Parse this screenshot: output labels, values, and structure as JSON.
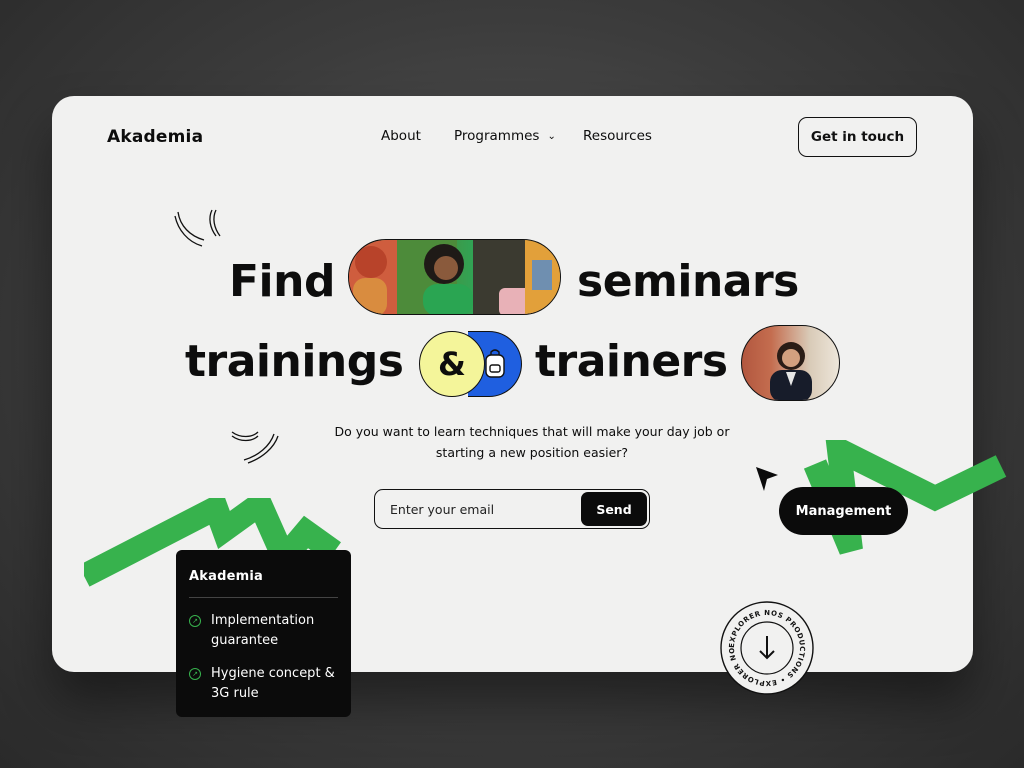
{
  "header": {
    "logo": "Akademia",
    "nav": [
      {
        "label": "About"
      },
      {
        "label": "Programmes",
        "has_dropdown": true
      },
      {
        "label": "Resources"
      }
    ],
    "cta_label": "Get in touch"
  },
  "hero": {
    "line1_left": "Find",
    "line1_right": "seminars",
    "line2_left": "trainings",
    "ampersand": "&",
    "line2_right": "trainers",
    "subtitle": "Do you want to learn techniques that will make your day job or starting a new position easier?"
  },
  "signup": {
    "email_placeholder": "Enter your email",
    "email_value": "",
    "send_label": "Send"
  },
  "info_card": {
    "logo": "Akademia",
    "items": [
      {
        "label": "Implementation guarantee"
      },
      {
        "label": "Hygiene concept & 3G rule"
      }
    ]
  },
  "floating": {
    "tag_label": "Management",
    "badge_text": "EXPLORER NOS PRODUCTIONS • EXPLORER NOS PRODUCTIONS •"
  },
  "colors": {
    "accent_green": "#37b24d",
    "accent_yellow": "#f4f59a",
    "accent_blue": "#1f5fe0",
    "card_bg": "#f1f1f0",
    "ink": "#0b0b0b"
  },
  "icons": [
    "chevron-down-icon",
    "backpack-icon",
    "arrow-up-right-icon",
    "cursor-arrow-icon",
    "arrow-down-icon"
  ]
}
